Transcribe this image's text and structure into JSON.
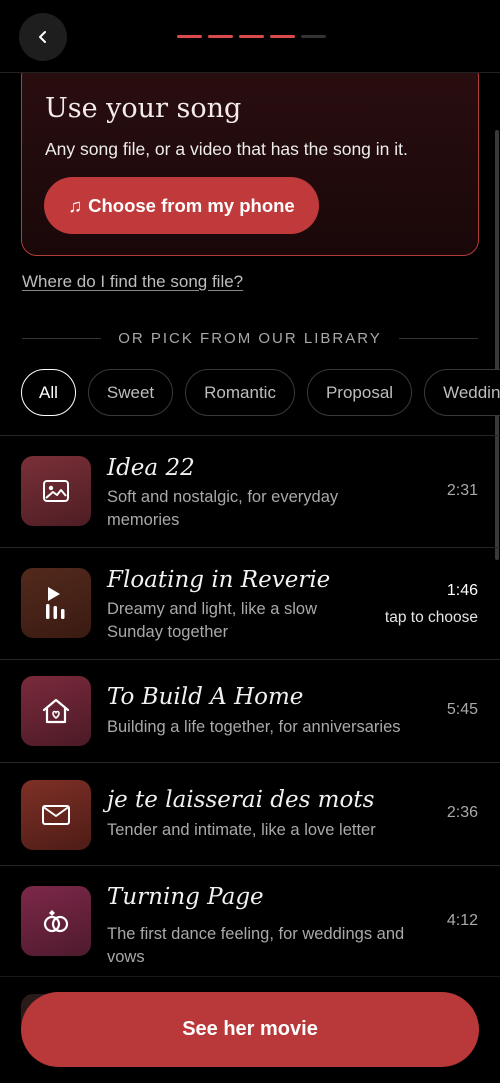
{
  "header": {
    "back_icon": "chevron-left-icon",
    "progress_total": 5,
    "progress_done": 4
  },
  "upload": {
    "title": "Use your song",
    "subtitle": "Any song file, or a video that has the song in it.",
    "choose_icon": "♫",
    "choose_label": "Choose from my phone",
    "help_link": "Where do I find the song file?"
  },
  "library": {
    "divider": "OR PICK FROM OUR LIBRARY",
    "chips": [
      {
        "label": "All",
        "active": true
      },
      {
        "label": "Sweet",
        "active": false
      },
      {
        "label": "Romantic",
        "active": false
      },
      {
        "label": "Proposal",
        "active": false
      },
      {
        "label": "Wedding",
        "active": false
      }
    ],
    "songs": [
      {
        "title": "Idea 22",
        "desc": "Soft and nostalgic, for everyday memories",
        "duration": "2:31",
        "icon": "image-icon",
        "color": "#6b2a30"
      },
      {
        "title": "Floating in Reverie",
        "desc": "Dreamy and light, like a slow Sunday together",
        "duration": "1:46",
        "hint": "tap to choose",
        "icon": "play-bars-icon",
        "color": "#4a2418"
      },
      {
        "title": "To Build A Home",
        "desc": "Building a life together, for anniversaries",
        "duration": "5:45",
        "icon": "home-heart-icon",
        "color": "#6a2535"
      },
      {
        "title": "je te laisserai des mots",
        "desc": "Tender and intimate, like a love letter",
        "duration": "2:36",
        "icon": "envelope-icon",
        "color": "#6e2a22"
      },
      {
        "title": "Turning Page",
        "desc": "The first dance feeling, for weddings and vows",
        "duration": "4:12",
        "icon": "rings-icon",
        "color": "#6d2340"
      }
    ]
  },
  "cta": {
    "label": "See her movie"
  },
  "colors": {
    "accent": "#c0393b",
    "card_border": "#b23c3c",
    "progress_active": "#d94a4a"
  }
}
